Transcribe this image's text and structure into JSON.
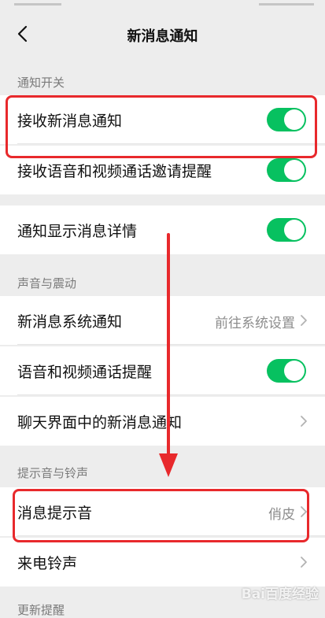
{
  "nav": {
    "title": "新消息通知"
  },
  "sections": {
    "notify_switch": "通知开关",
    "sound_vibration": "声音与震动",
    "tone_ringtone": "提示音与铃声",
    "update_reminder": "更新提醒"
  },
  "rows": {
    "receive_new": {
      "label": "接收新消息通知",
      "toggle_on": true
    },
    "voice_video_invite": {
      "label": "接收语音和视频通话邀请提醒",
      "toggle_on": true
    },
    "show_details": {
      "label": "通知显示消息详情",
      "toggle_on": true
    },
    "system_notify": {
      "label": "新消息系统通知",
      "value": "前往系统设置"
    },
    "voice_video_alert": {
      "label": "语音和视频通话提醒",
      "toggle_on": true
    },
    "chat_notify": {
      "label": "聊天界面中的新消息通知"
    },
    "message_tone": {
      "label": "消息提示音",
      "value": "俏皮"
    },
    "ringtone": {
      "label": "来电铃声"
    }
  },
  "colors": {
    "toggle_on": "#07c160",
    "highlight": "#e8292c",
    "background": "#ededed"
  },
  "watermark": "Bai百度经验"
}
